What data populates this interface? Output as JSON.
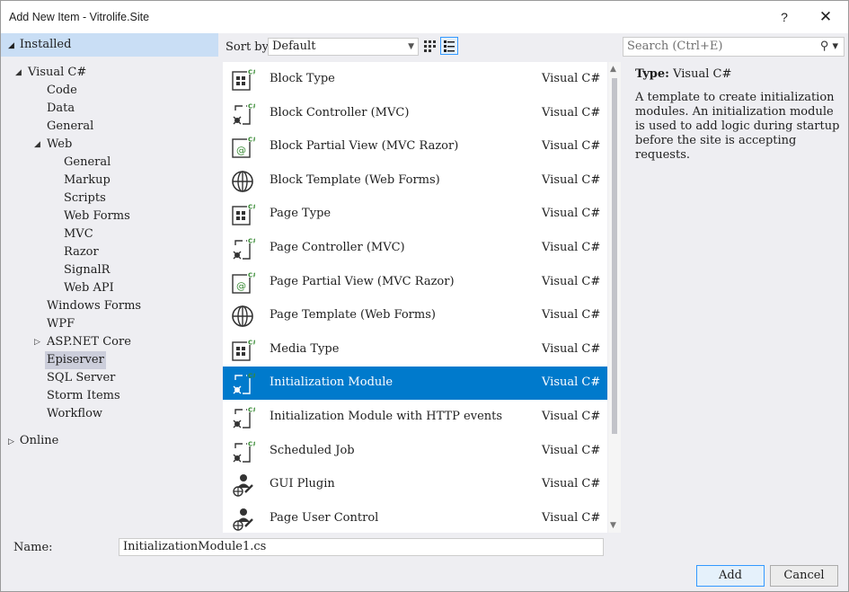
{
  "window": {
    "title": "Add New Item - Vitrolife.Site",
    "help_glyph": "?",
    "close_glyph": "✕"
  },
  "left": {
    "installed": "Installed",
    "online": "Online",
    "tree": [
      {
        "label": "Visual C#",
        "level": 0,
        "arrow": "◢"
      },
      {
        "label": "Code",
        "level": 1
      },
      {
        "label": "Data",
        "level": 1
      },
      {
        "label": "General",
        "level": 1
      },
      {
        "label": "Web",
        "level": 1,
        "arrow": "◢"
      },
      {
        "label": "General",
        "level": 2
      },
      {
        "label": "Markup",
        "level": 2
      },
      {
        "label": "Scripts",
        "level": 2
      },
      {
        "label": "Web Forms",
        "level": 2
      },
      {
        "label": "MVC",
        "level": 2
      },
      {
        "label": "Razor",
        "level": 2
      },
      {
        "label": "SignalR",
        "level": 2
      },
      {
        "label": "Web API",
        "level": 2
      },
      {
        "label": "Windows Forms",
        "level": 1
      },
      {
        "label": "WPF",
        "level": 1
      },
      {
        "label": "ASP.NET Core",
        "level": 1,
        "arrow": "▷"
      },
      {
        "label": "Episerver",
        "level": 1,
        "selected": true
      },
      {
        "label": "SQL Server",
        "level": 1
      },
      {
        "label": "Storm Items",
        "level": 1
      },
      {
        "label": "Workflow",
        "level": 1
      }
    ]
  },
  "toolbar": {
    "sort_label": "Sort by:",
    "sort_value": "Default"
  },
  "items": [
    {
      "name": "Block Type",
      "lang": "Visual C#",
      "icon": "type-icon"
    },
    {
      "name": "Block Controller (MVC)",
      "lang": "Visual C#",
      "icon": "controller-icon"
    },
    {
      "name": "Block Partial View (MVC Razor)",
      "lang": "Visual C#",
      "icon": "razor-view-icon"
    },
    {
      "name": "Block Template (Web Forms)",
      "lang": "Visual C#",
      "icon": "globe-icon"
    },
    {
      "name": "Page Type",
      "lang": "Visual C#",
      "icon": "type-icon"
    },
    {
      "name": "Page Controller (MVC)",
      "lang": "Visual C#",
      "icon": "controller-icon"
    },
    {
      "name": "Page Partial View (MVC Razor)",
      "lang": "Visual C#",
      "icon": "razor-view-icon"
    },
    {
      "name": "Page Template (Web Forms)",
      "lang": "Visual C#",
      "icon": "globe-icon"
    },
    {
      "name": "Media Type",
      "lang": "Visual C#",
      "icon": "type-icon"
    },
    {
      "name": "Initialization Module",
      "lang": "Visual C#",
      "icon": "controller-icon",
      "selected": true
    },
    {
      "name": "Initialization Module with HTTP events",
      "lang": "Visual C#",
      "icon": "controller-icon"
    },
    {
      "name": "Scheduled Job",
      "lang": "Visual C#",
      "icon": "controller-icon"
    },
    {
      "name": "GUI Plugin",
      "lang": "Visual C#",
      "icon": "user-control-icon"
    },
    {
      "name": "Page User Control",
      "lang": "Visual C#",
      "icon": "user-control-icon"
    }
  ],
  "search": {
    "placeholder": "Search (Ctrl+E)"
  },
  "details": {
    "type_label": "Type:",
    "type_value": "Visual C#",
    "description": "A template to create initialization modules. An initialization module is used to add logic during startup before the site is accepting requests."
  },
  "bottom": {
    "name_label": "Name:",
    "name_value": "InitializationModule1.cs",
    "add_label": "Add",
    "cancel_label": "Cancel"
  },
  "colors": {
    "selection": "#007acc",
    "installed_bg": "#c9def5",
    "csharp_badge": "#388a34"
  }
}
